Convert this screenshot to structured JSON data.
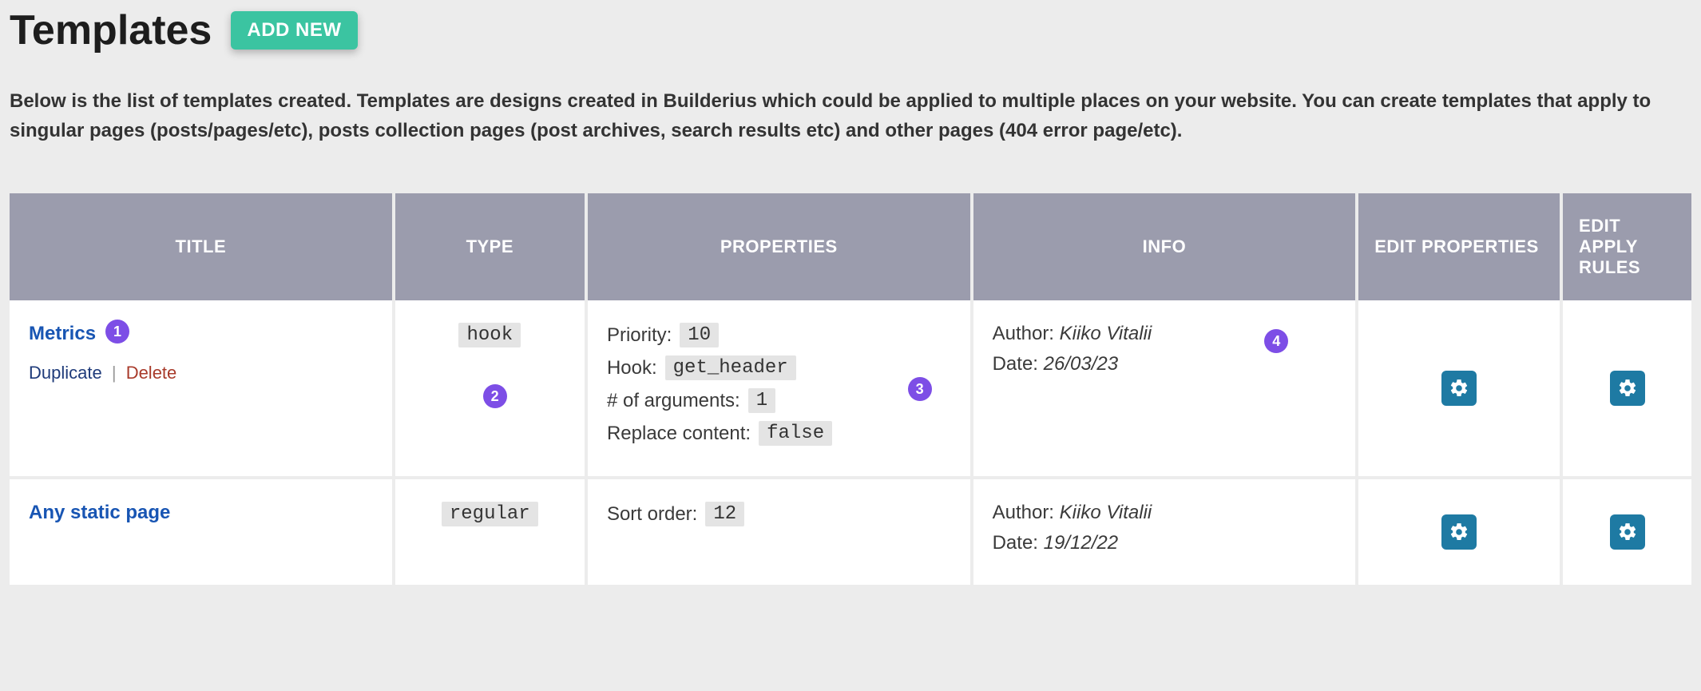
{
  "header": {
    "title": "Templates",
    "add_new_label": "ADD NEW"
  },
  "description": "Below is the list of templates created. Templates are designs created in Builderius which could be applied to multiple places on your website. You can create templates that apply to singular pages (posts/pages/etc), posts collection pages (post archives, search results etc) and other pages (404 error page/etc).",
  "columns": {
    "title": "TITLE",
    "type": "TYPE",
    "properties": "PROPERTIES",
    "info": "INFO",
    "edit_properties": "EDIT PROPERTIES",
    "edit_apply_rules": "EDIT APPLY RULES"
  },
  "row_actions": {
    "duplicate": "Duplicate",
    "delete": "Delete"
  },
  "property_labels": {
    "priority": "Priority:",
    "hook": "Hook:",
    "num_args": "# of arguments:",
    "replace_content": "Replace content:",
    "sort_order": "Sort order:"
  },
  "info_labels": {
    "author": "Author:",
    "date": "Date:"
  },
  "markers": {
    "m1": "1",
    "m2": "2",
    "m3": "3",
    "m4": "4"
  },
  "rows": [
    {
      "title": "Metrics",
      "type": "hook",
      "properties": {
        "priority": "10",
        "hook": "get_header",
        "num_args": "1",
        "replace_content": "false"
      },
      "info": {
        "author": "Kiiko Vitalii",
        "date": "26/03/23"
      },
      "show_actions": true,
      "markers": true
    },
    {
      "title": "Any static page",
      "type": "regular",
      "properties": {
        "sort_order": "12"
      },
      "info": {
        "author": "Kiiko Vitalii",
        "date": "19/12/22"
      },
      "show_actions": false,
      "markers": false
    }
  ]
}
